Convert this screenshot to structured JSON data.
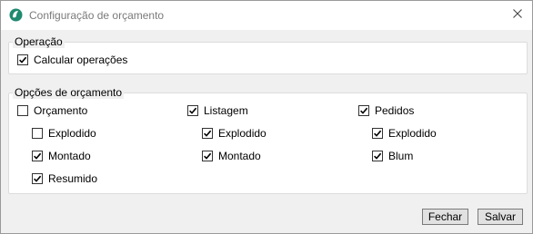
{
  "window": {
    "title": "Configuração de orçamento"
  },
  "operacao": {
    "group_label": "Operação",
    "calcular_operacoes": {
      "label": "Calcular operações",
      "checked": true
    }
  },
  "opcoes": {
    "group_label": "Opções de orçamento",
    "orcamento": {
      "label": "Orçamento",
      "checked": false
    },
    "orcamento_explodido": {
      "label": "Explodido",
      "checked": false
    },
    "orcamento_montado": {
      "label": "Montado",
      "checked": true
    },
    "orcamento_resumido": {
      "label": "Resumido",
      "checked": true
    },
    "listagem": {
      "label": "Listagem",
      "checked": true
    },
    "listagem_explodido": {
      "label": "Explodido",
      "checked": true
    },
    "listagem_montado": {
      "label": "Montado",
      "checked": true
    },
    "pedidos": {
      "label": "Pedidos",
      "checked": true
    },
    "pedidos_explodido": {
      "label": "Explodido",
      "checked": true
    },
    "pedidos_blum": {
      "label": "Blum",
      "checked": true
    }
  },
  "buttons": {
    "fechar": "Fechar",
    "salvar": "Salvar"
  },
  "colors": {
    "app_icon": "#1f8a70",
    "title_text": "#7a7a7a"
  },
  "icons": {
    "app": "app-logo-icon",
    "close": "close-icon",
    "check": "checkmark-icon"
  }
}
